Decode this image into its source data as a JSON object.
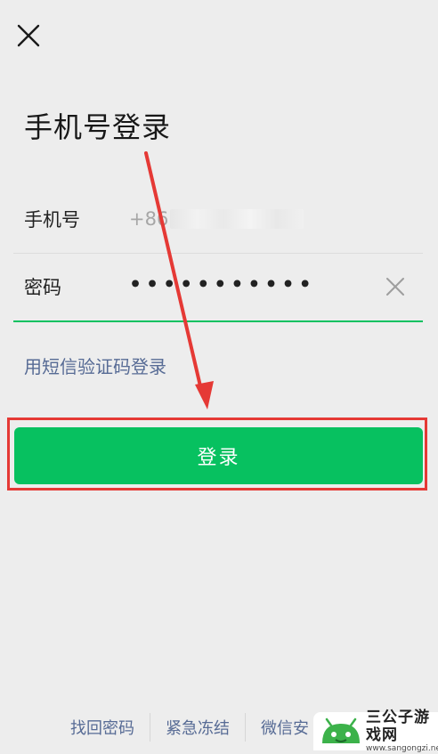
{
  "page": {
    "title": "手机号登录"
  },
  "form": {
    "phone_label": "手机号",
    "phone_prefix": "+86",
    "password_label": "密码",
    "password_value": "•••••••••••"
  },
  "sms_login_link": "用短信验证码登录",
  "login_button": "登录",
  "footer": {
    "links": [
      "找回密码",
      "紧急冻结",
      "微信安"
    ]
  },
  "watermark": {
    "name": "三公子游戏网",
    "url": "www.sangongzi.net"
  },
  "colors": {
    "background": "#ededed",
    "primary_green": "#07c160",
    "link_blue": "#576b95",
    "annotation_red": "#e53935"
  },
  "icons": {
    "close": "close-icon",
    "clear": "clear-input-icon",
    "watermark_logo": "android-logo-icon"
  }
}
